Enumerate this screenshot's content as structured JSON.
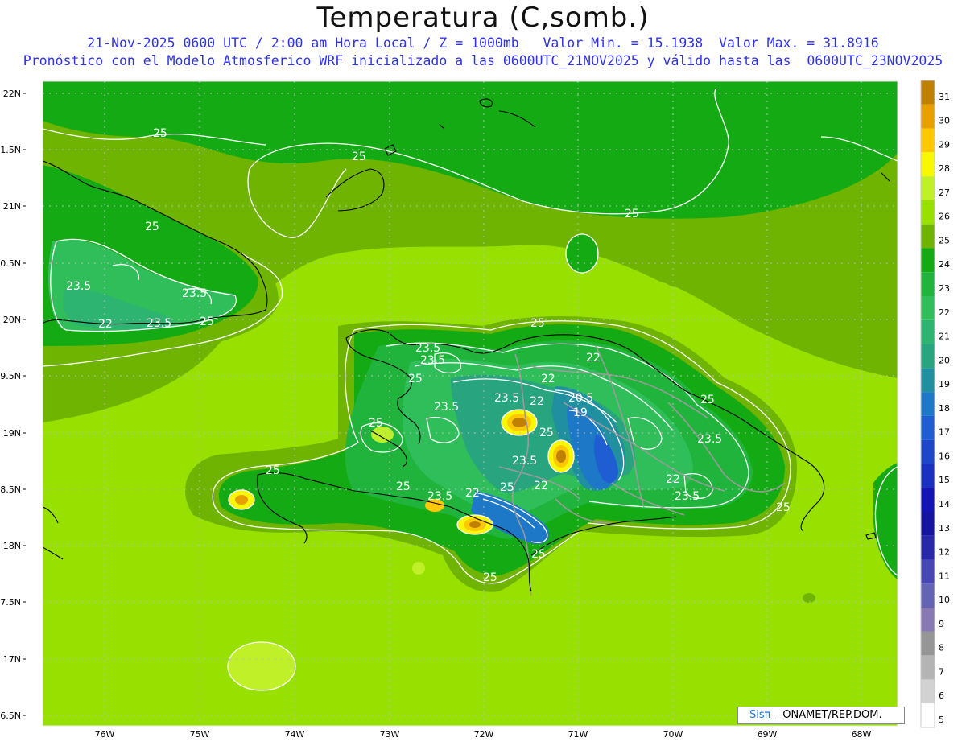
{
  "header": {
    "title": "Temperatura (C,somb.)",
    "line1": "21-Nov-2025 0600 UTC / 2:00 am Hora Local / Z = 1000mb   Valor Min. = 15.1938  Valor Max. = 31.8916",
    "line2": "Pronóstico con el Modelo Atmosferico WRF inicializado a las 0600UTC_21NOV2025 y válido hasta las  0600UTC_23NOV2025"
  },
  "axes": {
    "lat_labels": [
      "22N",
      "21.5N",
      "21N",
      "20.5N",
      "20N",
      "19.5N",
      "19N",
      "18.5N",
      "18N",
      "17.5N",
      "17N",
      "16.5N"
    ],
    "lon_labels": [
      "76W",
      "75W",
      "74W",
      "73W",
      "72W",
      "71W",
      "70W",
      "69W",
      "68W"
    ]
  },
  "colorbar": {
    "levels": [
      "31",
      "30",
      "29",
      "28",
      "27",
      "26",
      "25",
      "24",
      "23",
      "22",
      "21",
      "20",
      "19",
      "18",
      "17",
      "16",
      "15",
      "14",
      "13",
      "12",
      "11",
      "10",
      "9",
      "8",
      "7",
      "6",
      "5"
    ],
    "colors": [
      "#c08000",
      "#e8a000",
      "#ffc800",
      "#f8f800",
      "#c0f028",
      "#98e000",
      "#6eb400",
      "#14aa14",
      "#20b43c",
      "#30be5a",
      "#2cb470",
      "#28a47e",
      "#2090a0",
      "#1e78c8",
      "#1e5ed2",
      "#1e46c8",
      "#1a30c0",
      "#1414b4",
      "#1414a0",
      "#2828a8",
      "#4646b4",
      "#6464b4",
      "#8878b4",
      "#969696",
      "#b4b4b4",
      "#d2d2d2",
      "#ffffff"
    ]
  },
  "contour_labels": [
    "25",
    "25",
    "25",
    "25",
    "25",
    "23.5",
    "23.5",
    "22",
    "23.5",
    "25",
    "25",
    "23.5",
    "22",
    "22",
    "22",
    "25",
    "20.5",
    "19",
    "23.5",
    "23.5",
    "25",
    "25",
    "25",
    "23.5",
    "25",
    "23.5",
    "22",
    "25",
    "22",
    "23.5",
    "25",
    "25",
    "25"
  ],
  "credit": {
    "brand": "Sisπ",
    "text": " – ONAMET/REP.DOM."
  },
  "colors": {
    "title_blue": "#2f33e6",
    "grid": "#bdbdbd"
  }
}
